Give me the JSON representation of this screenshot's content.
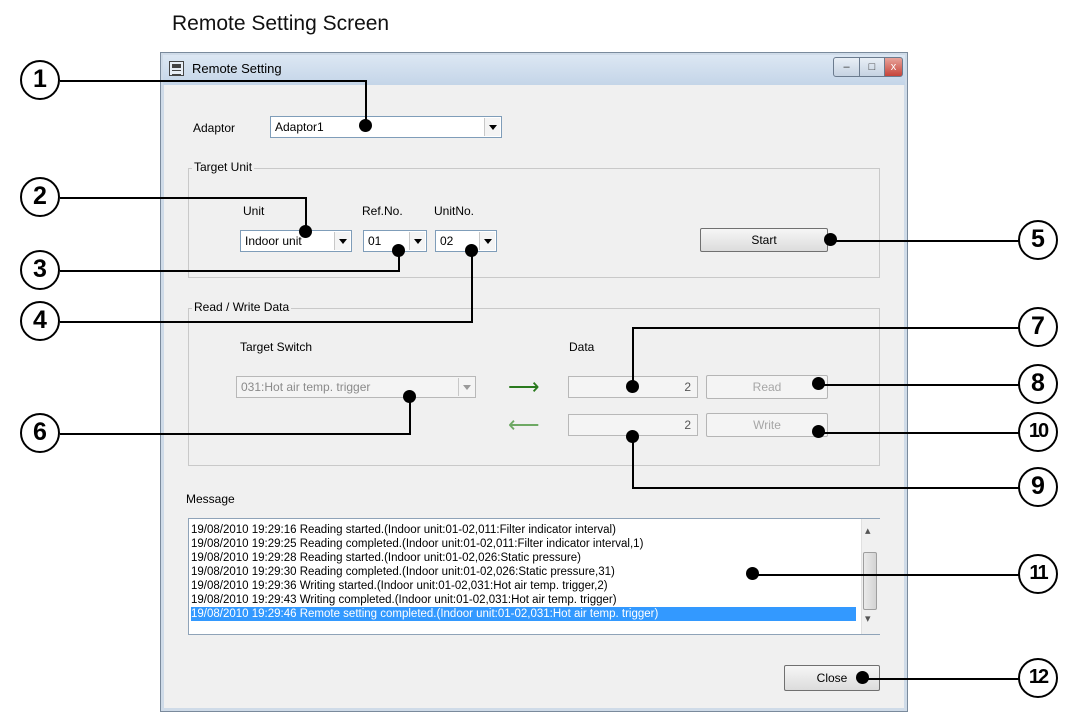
{
  "caption": "Remote Setting Screen",
  "window": {
    "title": "Remote Setting",
    "buttons": {
      "minimize": "–",
      "maximize": "□",
      "close": "x"
    }
  },
  "adaptor": {
    "label": "Adaptor",
    "value": "Adaptor1"
  },
  "target_unit": {
    "legend": "Target Unit",
    "unit_label": "Unit",
    "ref_label": "Ref.No.",
    "unitno_label": "UnitNo.",
    "unit_value": "Indoor unit",
    "ref_value": "01",
    "unitno_value": "02",
    "start_label": "Start"
  },
  "rw": {
    "legend": "Read / Write Data",
    "switch_label": "Target Switch",
    "switch_value": "031:Hot air temp. trigger",
    "data_label": "Data",
    "read_value": "2",
    "write_value": "2",
    "read_label": "Read",
    "write_label": "Write",
    "arrow_right": "⟶",
    "arrow_left": "⟵"
  },
  "message": {
    "label": "Message",
    "lines": [
      "19/08/2010 19:29:16 Reading started.(Indoor unit:01-02,011:Filter indicator interval)",
      "19/08/2010 19:29:25 Reading completed.(Indoor unit:01-02,011:Filter indicator interval,1)",
      "19/08/2010 19:29:28 Reading started.(Indoor unit:01-02,026:Static pressure)",
      "19/08/2010 19:29:30 Reading completed.(Indoor unit:01-02,026:Static pressure,31)",
      "19/08/2010 19:29:36 Writing started.(Indoor unit:01-02,031:Hot air temp. trigger,2)",
      "19/08/2010 19:29:43 Writing completed.(Indoor unit:01-02,031:Hot air temp. trigger)",
      "19/08/2010 19:29:46 Remote setting completed.(Indoor unit:01-02,031:Hot air temp. trigger)"
    ],
    "scroll_up": "▴",
    "scroll_down": "▾"
  },
  "close_label": "Close",
  "callouts": [
    "①",
    "②",
    "③",
    "④",
    "⑤",
    "⑥",
    "⑦",
    "⑧",
    "⑨",
    "⑩",
    "⑪",
    "⑫"
  ],
  "callout_digits": [
    "1",
    "2",
    "3",
    "4",
    "5",
    "6",
    "7",
    "8",
    "9",
    "10",
    "11",
    "12"
  ]
}
